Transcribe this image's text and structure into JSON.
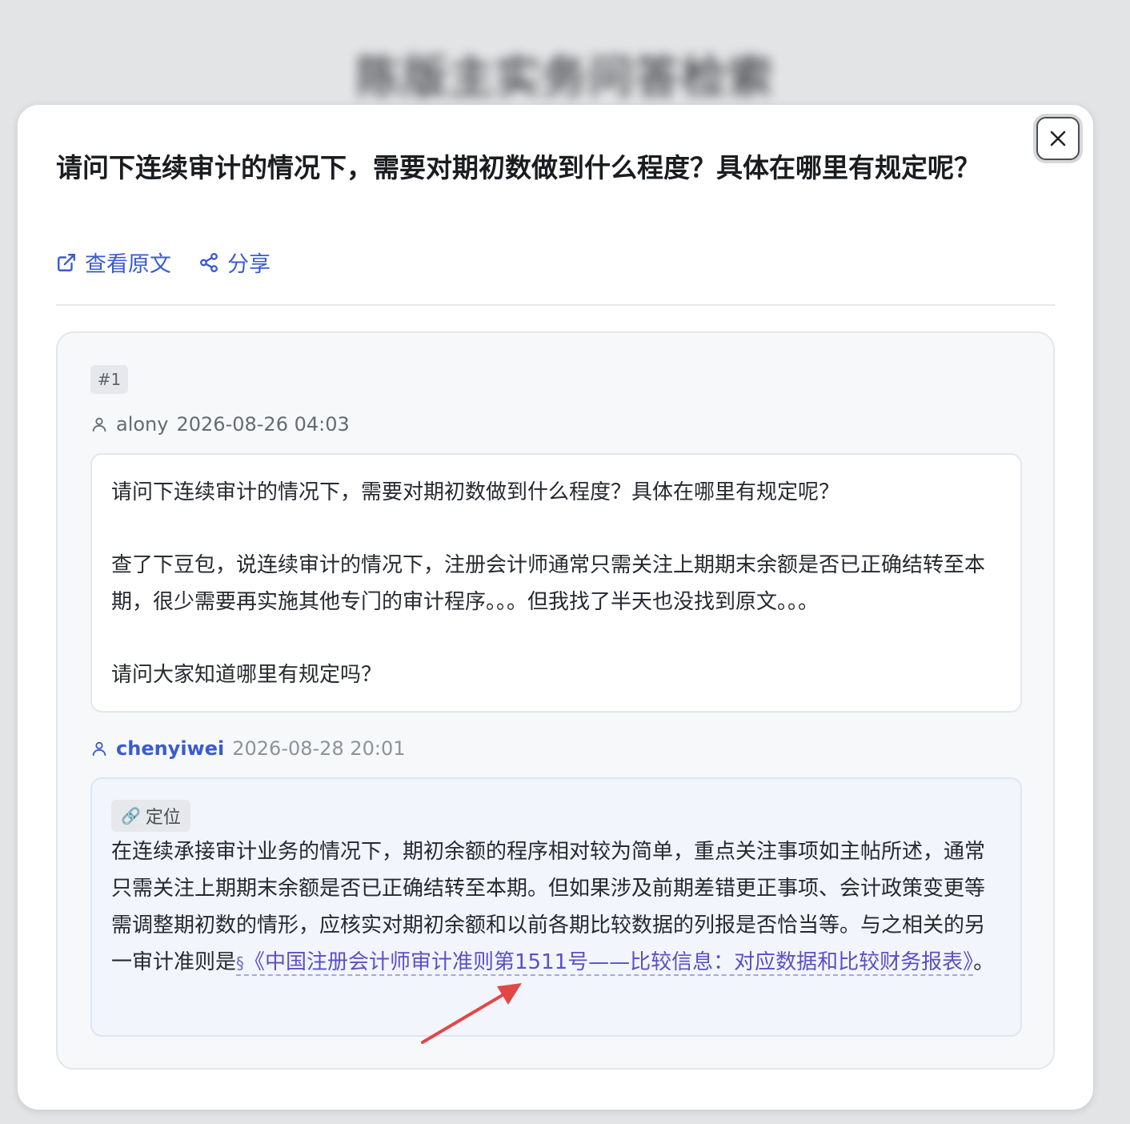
{
  "backdrop": {
    "title": "陈版主实务问答检索"
  },
  "modal": {
    "title": "请问下连续审计的情况下，需要对期初数做到什么程度？具体在哪里有规定呢？",
    "actions": {
      "view_original": "查看原文",
      "share": "分享"
    }
  },
  "post": {
    "floor": "#1",
    "author": "alony",
    "time": "2026-08-26 04:03",
    "paragraphs": [
      "请问下连续审计的情况下，需要对期初数做到什么程度？具体在哪里有规定呢？",
      "查了下豆包，说连续审计的情况下，注册会计师通常只需关注上期期末余额是否已正确结转至本期，很少需要再实施其他专门的审计程序。。。但我找了半天也没找到原文。。。",
      "请问大家知道哪里有规定吗？"
    ]
  },
  "reply": {
    "author": "chenyiwei",
    "time": "2026-08-28 20:01",
    "locate_label": "定位",
    "text_before": "在连续承接审计业务的情况下，期初余额的程序相对较为简单，重点关注事项如主帖所述，通常只需关注上期期末余额是否已正确结转至本期。但如果涉及前期差错更正事项、会计政策变更等需调整期初数的情形，应核实对期初余额和以前各期比较数据的列报是否恰当等。与之相关的另一审计准则是",
    "link_symbol": "§",
    "link_text": "《中国注册会计师审计准则第1511号——比较信息：对应数据和比较财务报表》",
    "text_after": "。"
  },
  "colors": {
    "accent": "#3a5ccc",
    "link": "#5b4fc6",
    "annotation_arrow": "#e04848"
  },
  "icons": {
    "close": "close-icon",
    "view_original": "external-link-icon",
    "share": "share-icon",
    "user": "user-icon",
    "locate": "link-chain-icon"
  }
}
